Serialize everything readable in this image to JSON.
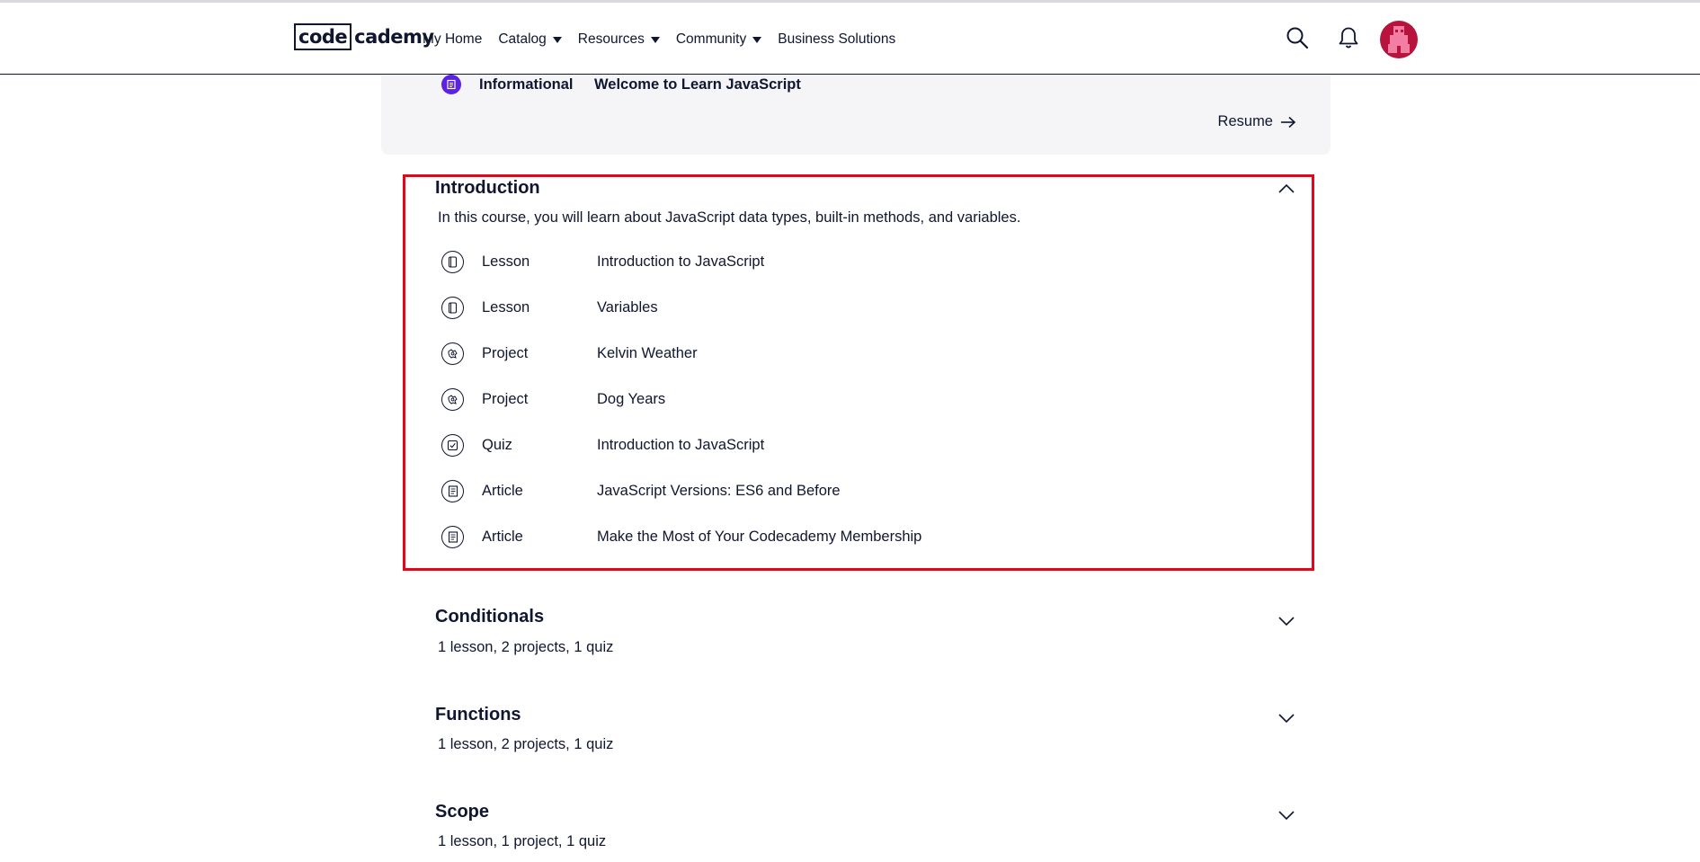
{
  "header": {
    "logo_box": "code",
    "logo_rest": "cademy",
    "nav": [
      {
        "label": "My Home",
        "dropdown": false
      },
      {
        "label": "Catalog",
        "dropdown": true
      },
      {
        "label": "Resources",
        "dropdown": true
      },
      {
        "label": "Community",
        "dropdown": true
      },
      {
        "label": "Business Solutions",
        "dropdown": false
      }
    ],
    "icons": [
      "search-icon",
      "bell-icon",
      "avatar"
    ]
  },
  "info_card": {
    "type": "Informational",
    "title": "Welcome to Learn JavaScript",
    "resume_label": "Resume",
    "accent": "#5b21e6"
  },
  "sections": [
    {
      "title": "Introduction",
      "expanded": true,
      "description": "In this course, you will learn about JavaScript data types, built-in methods, and variables.",
      "items": [
        {
          "type": "Lesson",
          "title": "Introduction to JavaScript",
          "icon": "lesson-icon"
        },
        {
          "type": "Lesson",
          "title": "Variables",
          "icon": "lesson-icon"
        },
        {
          "type": "Project",
          "title": "Kelvin Weather",
          "icon": "project-icon"
        },
        {
          "type": "Project",
          "title": "Dog Years",
          "icon": "project-icon"
        },
        {
          "type": "Quiz",
          "title": "Introduction to JavaScript",
          "icon": "quiz-icon"
        },
        {
          "type": "Article",
          "title": "JavaScript Versions: ES6 and Before",
          "icon": "article-icon"
        },
        {
          "type": "Article",
          "title": "Make the Most of Your Codecademy Membership",
          "icon": "article-icon"
        }
      ]
    },
    {
      "title": "Conditionals",
      "expanded": false,
      "summary": "1 lesson, 2 projects, 1 quiz"
    },
    {
      "title": "Functions",
      "expanded": false,
      "summary": "1 lesson, 2 projects, 1 quiz"
    },
    {
      "title": "Scope",
      "expanded": false,
      "summary": "1 lesson, 1 project, 1 quiz"
    }
  ],
  "colors": {
    "text": "#10162f",
    "highlight": "#e2071b",
    "card_bg": "#f5f5f8",
    "avatar": "#b8133c"
  }
}
